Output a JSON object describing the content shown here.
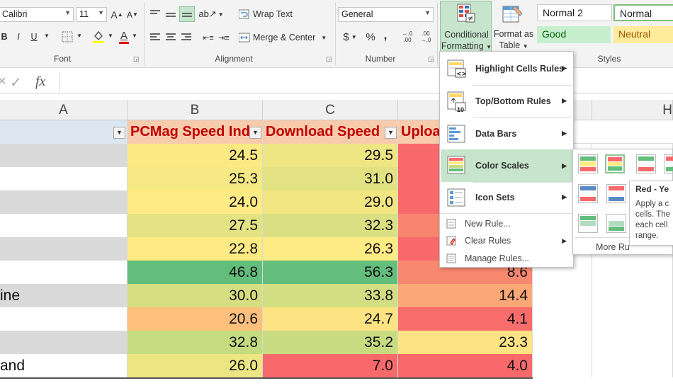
{
  "ribbon": {
    "font": {
      "font_name": "Calibri",
      "font_size": "11",
      "grow_label": "A",
      "shrink_label": "A",
      "bold": "B",
      "italic": "I",
      "underline": "U",
      "font_color_glyph": "A",
      "group_label": "Font"
    },
    "alignment": {
      "wrap_text": "Wrap Text",
      "merge_center": "Merge & Center",
      "group_label": "Alignment"
    },
    "number": {
      "format": "General",
      "currency": "$",
      "percent": "%",
      "comma": ",",
      "inc_decimal": "←.0 .00",
      "dec_decimal": ".00 →.0",
      "group_label": "Number"
    },
    "conditional_formatting": {
      "line1": "Conditional",
      "line2": "Formatting"
    },
    "format_as_table": {
      "line1": "Format as",
      "line2": "Table"
    },
    "styles": {
      "items": [
        {
          "label": "Normal 2",
          "bg": "#ffffff",
          "fg": "#222222"
        },
        {
          "label": "Normal",
          "bg": "#ffffff",
          "fg": "#222222"
        },
        {
          "label": "Good",
          "bg": "#c6efce",
          "fg": "#006100"
        },
        {
          "label": "Neutral",
          "bg": "#ffeb9c",
          "fg": "#9c5700"
        }
      ],
      "group_label": "Styles"
    }
  },
  "formula_bar": {
    "cancel_glyph": "✕",
    "enter_glyph": "✓",
    "fx": "fx"
  },
  "columns": [
    "A",
    "B",
    "C",
    "H"
  ],
  "table": {
    "headers": [
      "PCMag Speed Inde",
      "Download Speed",
      "Uploa"
    ],
    "rows": [
      {
        "a": "",
        "b": "24.5",
        "c": "29.5",
        "d": "",
        "bc": "#fbe983",
        "cc": "#eee583",
        "dc": "#f8696b"
      },
      {
        "a": "",
        "b": "25.3",
        "c": "31.0",
        "d": "",
        "bc": "#f6e984",
        "cc": "#e2e283",
        "dc": "#f8696b"
      },
      {
        "a": "",
        "b": "24.0",
        "c": "29.0",
        "d": "",
        "bc": "#ffeb84",
        "cc": "#f2e683",
        "dc": "#f8696b"
      },
      {
        "a": "",
        "b": "27.5",
        "c": "32.3",
        "d": "",
        "bc": "#e3e383",
        "cc": "#dae081",
        "dc": "#f98570"
      },
      {
        "a": "",
        "b": "22.8",
        "c": "26.3",
        "d": "",
        "bc": "#ffea84",
        "cc": "#ffeb84",
        "dc": "#f8696b"
      },
      {
        "a": "",
        "b": "46.8",
        "c": "56.3",
        "d": "8.6",
        "bc": "#63be7b",
        "cc": "#63be7b",
        "dc": "#f98870"
      },
      {
        "a": "ine",
        "b": "30.0",
        "c": "33.8",
        "d": "14.4",
        "bc": "#d5df81",
        "cc": "#d1de81",
        "dc": "#fba776"
      },
      {
        "a": "",
        "b": "20.6",
        "c": "24.7",
        "d": "4.1",
        "bc": "#fdc07c",
        "cc": "#fee382",
        "dc": "#f86c6b"
      },
      {
        "a": "",
        "b": "32.8",
        "c": "35.2",
        "d": "23.3",
        "bc": "#c4db80",
        "cc": "#c8db80",
        "dc": "#fee382"
      },
      {
        "a": "and",
        "b": "26.0",
        "c": "7.0",
        "d": "4.0",
        "bc": "#ede583",
        "cc": "#f8696b",
        "dc": "#f8696b"
      }
    ]
  },
  "cf_menu": {
    "items": [
      {
        "label": "Highlight Cells Rules",
        "arrow": "▶"
      },
      {
        "label": "Top/Bottom Rules",
        "arrow": "▶",
        "icon_text": "10"
      },
      {
        "label": "Data Bars",
        "arrow": "▶"
      },
      {
        "label": "Color Scales",
        "arrow": "▶"
      },
      {
        "label": "Icon Sets",
        "arrow": "▶"
      }
    ],
    "small_items": [
      {
        "label": "New Rule..."
      },
      {
        "label": "Clear Rules",
        "arrow": "▶"
      },
      {
        "label": "Manage Rules..."
      }
    ]
  },
  "color_scales": {
    "more_rules": "More Ru",
    "tooltip": {
      "title": "Red - Ye",
      "lines": [
        "Apply a c",
        "cells. The",
        "each cell",
        "range."
      ]
    }
  }
}
